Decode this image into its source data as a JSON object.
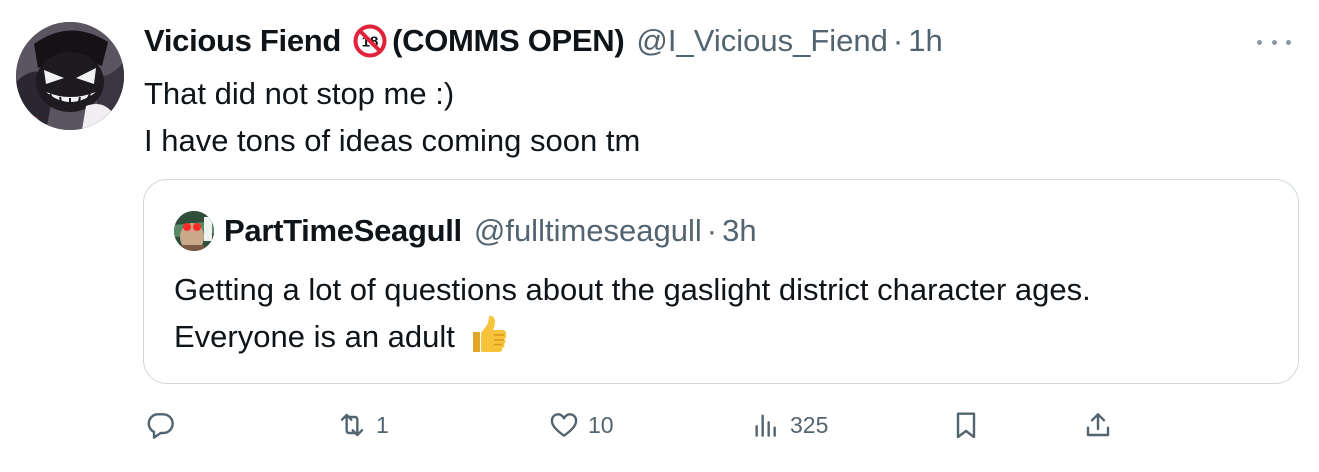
{
  "tweet": {
    "display_name": "Vicious Fiend",
    "name_suffix": "(COMMS OPEN)",
    "handle": "@I_Vicious_Fiend",
    "separator": "·",
    "time": "1h",
    "more_icon": "more-horizontal-icon",
    "text_lines": [
      "That did not stop me :)",
      "I have tons of ideas coming soon tm"
    ]
  },
  "quote": {
    "display_name": "PartTimeSeagull",
    "handle": "@fulltimeseagull",
    "separator": "·",
    "time": "3h",
    "text_lines": [
      "Getting a lot of questions about the gaslight district character ages.",
      "Everyone is an adult"
    ],
    "emoji": "thumbs-up-emoji"
  },
  "actions": {
    "reply": {
      "icon": "reply-icon",
      "count": ""
    },
    "retweet": {
      "icon": "retweet-icon",
      "count": "1"
    },
    "like": {
      "icon": "heart-icon",
      "count": "10"
    },
    "views": {
      "icon": "views-chart-icon",
      "count": "325"
    },
    "bookmark": {
      "icon": "bookmark-icon"
    },
    "share": {
      "icon": "share-icon"
    }
  },
  "colors": {
    "text_primary": "#0f1419",
    "text_secondary": "#536471",
    "border": "#cfd9de",
    "no18_red": "#e0223a",
    "thumb_yellow": "#f6c33b"
  }
}
